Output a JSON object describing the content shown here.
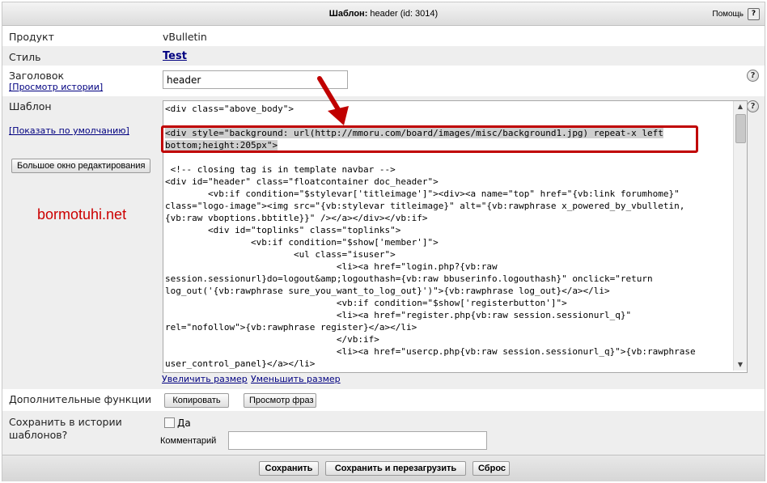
{
  "header": {
    "title_bold": "Шаблон:",
    "title_rest": " header (id: 3014)",
    "help_label": "Помощь",
    "help_icon": "?"
  },
  "rows": {
    "product_label": "Продукт",
    "product_value": "vBulletin",
    "style_label": "Стиль",
    "style_value": "Test",
    "title_label": "Заголовок",
    "history_link": "[Просмотр истории]",
    "title_value": "header",
    "template_label": "Шаблон",
    "show_default_link": "[Показать по умолчанию]",
    "big_editor_button": "Большое окно редактирования",
    "enlarge_link": "Увеличить размер",
    "shrink_link": "Уменьшить размер",
    "extra_label": "Дополнительные функции",
    "copy_button": "Копировать",
    "phrases_button": "Просмотр фраз",
    "save_history_label_1": "Сохранить в истории",
    "save_history_label_2": "шаблонов?",
    "save_history_checkbox": "Да",
    "comment_label": "Комментарий",
    "comment_value": ""
  },
  "code": {
    "line_01": "<div class=\"above_body\">",
    "line_02": "",
    "line_03": "<div style=\"background: url(http://mmoru.com/board/images/misc/background1.jpg) repeat-x left",
    "line_04": "bottom;height:205px\">",
    "line_05": "",
    "line_06": " <!-- closing tag is in template navbar -->",
    "line_07": "<div id=\"header\" class=\"floatcontainer doc_header\">",
    "line_08": "        <vb:if condition=\"$stylevar['titleimage']\"><div><a name=\"top\" href=\"{vb:link forumhome}\"",
    "line_09": "class=\"logo-image\"><img src=\"{vb:stylevar titleimage}\" alt=\"{vb:rawphrase x_powered_by_vbulletin,",
    "line_10": "{vb:raw vboptions.bbtitle}}\" /></a></div></vb:if>",
    "line_11": "        <div id=\"toplinks\" class=\"toplinks\">",
    "line_12": "                <vb:if condition=\"$show['member']\">",
    "line_13": "                        <ul class=\"isuser\">",
    "line_14": "                                <li><a href=\"login.php?{vb:raw",
    "line_15": "session.sessionurl}do=logout&amp;logouthash={vb:raw bbuserinfo.logouthash}\" onclick=\"return",
    "line_16": "log_out('{vb:rawphrase sure_you_want_to_log_out}')\">{vb:rawphrase log_out}</a></li>",
    "line_17": "                                <vb:if condition=\"$show['registerbutton']\">",
    "line_18": "                                <li><a href=\"register.php{vb:raw session.sessionurl_q}\"",
    "line_19": "rel=\"nofollow\">{vb:rawphrase register}</a></li>",
    "line_20": "                                </vb:if>",
    "line_21": "                                <li><a href=\"usercp.php{vb:raw session.sessionurl_q}\">{vb:rawphrase",
    "line_22": "user_control_panel}</a></li>"
  },
  "footer": {
    "save_button": "Сохранить",
    "save_reload_button": "Сохранить и перезагрузить",
    "reset_button": "Сброс"
  },
  "watermark": "bormotuhi.net",
  "icons": {
    "question_icon": "?"
  },
  "colors": {
    "highlight_box": "#c00000",
    "link": "#000080"
  }
}
